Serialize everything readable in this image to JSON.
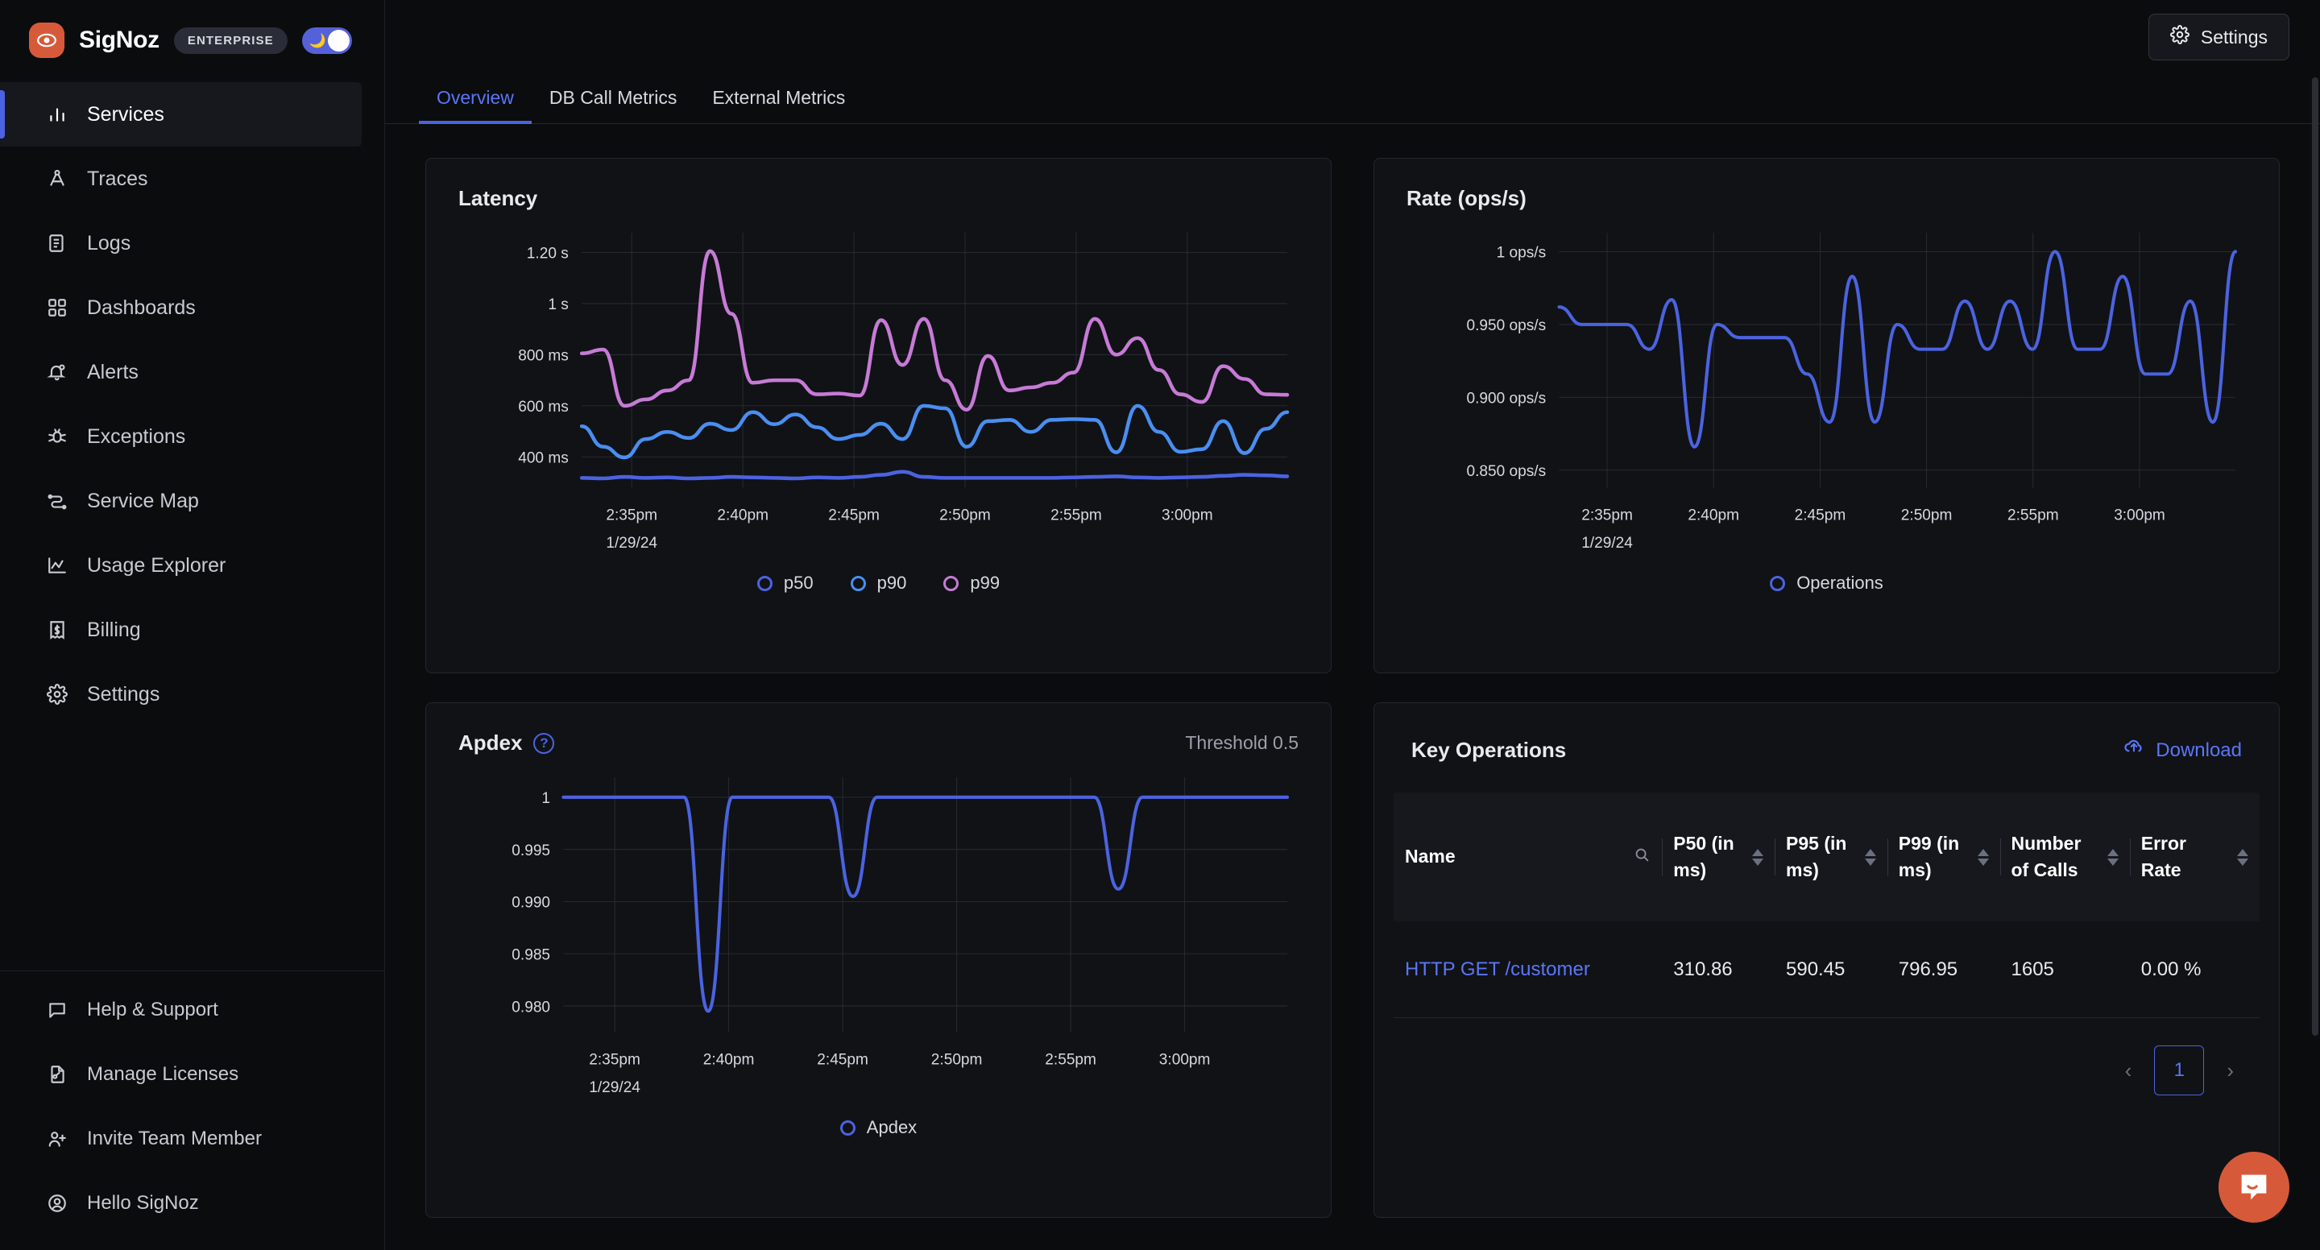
{
  "brand": {
    "name": "SigNoz",
    "badge": "ENTERPRISE",
    "logo_icon": "eye-logo-icon",
    "theme_toggle_icon": "moon-icon"
  },
  "sidebar": {
    "items": [
      {
        "label": "Services",
        "icon": "bar-chart-icon",
        "active": true
      },
      {
        "label": "Traces",
        "icon": "traces-icon",
        "active": false
      },
      {
        "label": "Logs",
        "icon": "logs-scroll-icon",
        "active": false
      },
      {
        "label": "Dashboards",
        "icon": "grid-squares-icon",
        "active": false
      },
      {
        "label": "Alerts",
        "icon": "bell-icon",
        "active": false
      },
      {
        "label": "Exceptions",
        "icon": "bug-icon",
        "active": false
      },
      {
        "label": "Service Map",
        "icon": "service-map-icon",
        "active": false
      },
      {
        "label": "Usage Explorer",
        "icon": "area-chart-icon",
        "active": false
      },
      {
        "label": "Billing",
        "icon": "receipt-dollar-icon",
        "active": false
      },
      {
        "label": "Settings",
        "icon": "gear-icon",
        "active": false
      }
    ],
    "bottom_items": [
      {
        "label": "Help & Support",
        "icon": "message-square-icon"
      },
      {
        "label": "Manage Licenses",
        "icon": "file-key-icon"
      },
      {
        "label": "Invite Team Member",
        "icon": "user-plus-icon"
      },
      {
        "label": "Hello SigNoz",
        "icon": "user-circle-icon"
      }
    ]
  },
  "topbar": {
    "settings_label": "Settings",
    "settings_icon": "gear-icon"
  },
  "tabs": [
    {
      "label": "Overview",
      "active": true
    },
    {
      "label": "DB Call Metrics",
      "active": false
    },
    {
      "label": "External Metrics",
      "active": false
    }
  ],
  "latency": {
    "title": "Latency"
  },
  "rate": {
    "title": "Rate (ops/s)"
  },
  "apdex": {
    "title": "Apdex",
    "help_icon": "question-circle-icon",
    "threshold": "Threshold 0.5"
  },
  "key_operations": {
    "title": "Key Operations",
    "download_label": "Download",
    "download_icon": "download-cloud-icon",
    "search_icon": "search-icon",
    "sort_icon": "sort-arrows-icon",
    "columns": [
      {
        "label": "Name",
        "sortable": false,
        "searchable": true
      },
      {
        "label": "P50 (in ms)",
        "sortable": true,
        "searchable": false
      },
      {
        "label": "P95 (in ms)",
        "sortable": true,
        "searchable": false
      },
      {
        "label": "P99 (in ms)",
        "sortable": true,
        "searchable": false
      },
      {
        "label": "Number of Calls",
        "sortable": true,
        "searchable": false
      },
      {
        "label": "Error Rate",
        "sortable": true,
        "searchable": false
      }
    ],
    "rows": [
      {
        "name": "HTTP GET /customer",
        "p50": "310.86",
        "p95": "590.45",
        "p99": "796.95",
        "calls": "1605",
        "error_rate": "0.00 %"
      }
    ],
    "pagination": {
      "prev_icon": "chevron-left-icon",
      "next_icon": "chevron-right-icon",
      "current_page": "1"
    }
  },
  "chat": {
    "icon": "chat-bubble-icon"
  },
  "colors": {
    "p50": "#4b63e0",
    "p90": "#4a8ef0",
    "p99": "#c77ad6",
    "operations": "#4b63e0",
    "apdex": "#4b63e0",
    "accent": "#5b76f7",
    "brand": "#d65a3a"
  },
  "chart_data": [
    {
      "type": "line",
      "id": "latency",
      "title": "Latency",
      "xlabel": "",
      "ylabel": "",
      "grid": true,
      "legend_position": "bottom",
      "x_tick_labels": [
        "2:35pm",
        "2:40pm",
        "2:45pm",
        "2:50pm",
        "2:55pm",
        "3:00pm"
      ],
      "x_date_label": "1/29/24",
      "y_tick_labels": [
        "400 ms",
        "600 ms",
        "800 ms",
        "1 s",
        "1.20 s"
      ],
      "y_tick_values": [
        400,
        600,
        800,
        1000,
        1200
      ],
      "ylim": [
        280,
        1260
      ],
      "unit": "ms",
      "series": [
        {
          "name": "p50",
          "color": "#4b63e0",
          "values": [
            318,
            316,
            322,
            318,
            320,
            316,
            318,
            322,
            320,
            318,
            316,
            320,
            318,
            322,
            330,
            342,
            322,
            318,
            318,
            318,
            318,
            318,
            318,
            320,
            322,
            324,
            320,
            318,
            320,
            322,
            326,
            330,
            328,
            324
          ]
        },
        {
          "name": "p90",
          "color": "#4a8ef0",
          "values": [
            520,
            440,
            398,
            470,
            498,
            474,
            530,
            505,
            575,
            528,
            566,
            516,
            470,
            486,
            530,
            470,
            600,
            590,
            440,
            540,
            545,
            498,
            545,
            548,
            545,
            418,
            600,
            498,
            420,
            430,
            540,
            415,
            510,
            575
          ]
        },
        {
          "name": "p99",
          "color": "#c77ad6",
          "values": [
            805,
            820,
            600,
            625,
            660,
            700,
            1205,
            960,
            690,
            700,
            700,
            645,
            648,
            640,
            935,
            760,
            940,
            700,
            585,
            795,
            660,
            672,
            690,
            730,
            940,
            800,
            865,
            740,
            645,
            615,
            755,
            705,
            645,
            643
          ]
        }
      ]
    },
    {
      "type": "line",
      "id": "rate",
      "title": "Rate (ops/s)",
      "xlabel": "",
      "ylabel": "",
      "grid": true,
      "legend_position": "bottom",
      "x_tick_labels": [
        "2:35pm",
        "2:40pm",
        "2:45pm",
        "2:50pm",
        "2:55pm",
        "3:00pm"
      ],
      "x_date_label": "1/29/24",
      "y_tick_labels": [
        "0.850 ops/s",
        "0.900 ops/s",
        "0.950 ops/s",
        "1 ops/s"
      ],
      "y_tick_values": [
        0.85,
        0.9,
        0.95,
        1.0
      ],
      "ylim": [
        0.838,
        1.01
      ],
      "unit": "ops/s",
      "series": [
        {
          "name": "Operations",
          "color": "#4b63e0",
          "values": [
            0.962,
            0.95,
            0.95,
            0.95,
            0.933,
            0.967,
            0.866,
            0.95,
            0.941,
            0.941,
            0.941,
            0.916,
            0.883,
            0.983,
            0.883,
            0.95,
            0.933,
            0.933,
            0.966,
            0.933,
            0.966,
            0.933,
            1.0,
            0.933,
            0.933,
            0.983,
            0.916,
            0.916,
            0.966,
            0.883,
            1.0
          ]
        }
      ]
    },
    {
      "type": "line",
      "id": "apdex",
      "title": "Apdex",
      "xlabel": "",
      "ylabel": "",
      "grid": true,
      "legend_position": "bottom",
      "annotation": "Threshold 0.5",
      "x_tick_labels": [
        "2:35pm",
        "2:40pm",
        "2:45pm",
        "2:50pm",
        "2:55pm",
        "3:00pm"
      ],
      "x_date_label": "1/29/24",
      "y_tick_labels": [
        "0.980",
        "0.985",
        "0.990",
        "0.995",
        "1"
      ],
      "y_tick_values": [
        0.98,
        0.985,
        0.99,
        0.995,
        1.0
      ],
      "ylim": [
        0.9775,
        1.0015
      ],
      "series": [
        {
          "name": "Apdex",
          "color": "#4b63e0",
          "values": [
            1.0,
            1.0,
            1.0,
            1.0,
            1.0,
            1.0,
            0.9795,
            1.0,
            1.0,
            1.0,
            1.0,
            1.0,
            0.9905,
            1.0,
            1.0,
            1.0,
            1.0,
            1.0,
            1.0,
            1.0,
            1.0,
            1.0,
            1.0,
            0.9912,
            1.0,
            1.0,
            1.0,
            1.0,
            1.0,
            1.0,
            1.0
          ]
        }
      ]
    }
  ]
}
